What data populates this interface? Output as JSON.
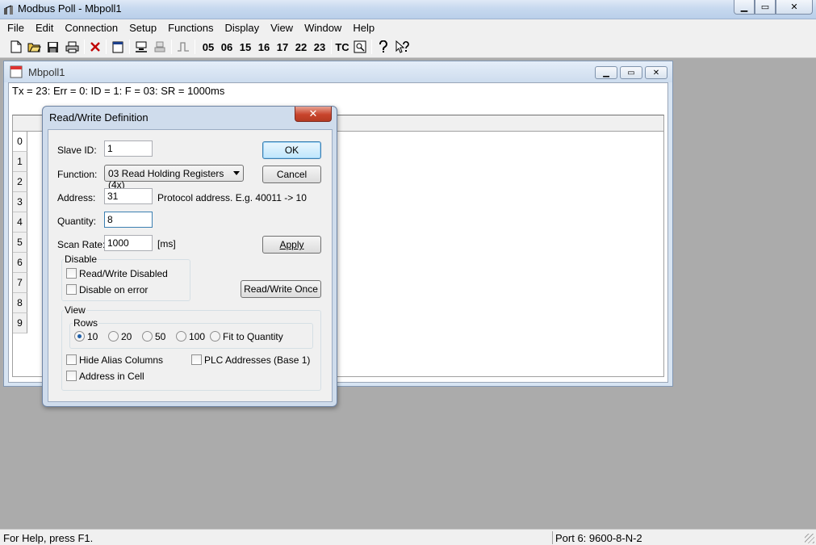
{
  "window": {
    "title": "Modbus Poll - Mbpoll1",
    "min_glyph": "▁",
    "max_glyph": "▭",
    "close_glyph": "✕"
  },
  "menu": [
    "File",
    "Edit",
    "Connection",
    "Setup",
    "Functions",
    "Display",
    "View",
    "Window",
    "Help"
  ],
  "toolbar": {
    "function_codes": [
      "05",
      "06",
      "15",
      "16",
      "17",
      "22",
      "23"
    ],
    "tc_label": "TC"
  },
  "child": {
    "title": "Mbpoll1",
    "status_line": "Tx = 23: Err = 0: ID = 1: F = 03: SR = 1000ms",
    "row_numbers": [
      "0",
      "1",
      "2",
      "3",
      "4",
      "5",
      "6",
      "7",
      "8",
      "9"
    ]
  },
  "dialog": {
    "title": "Read/Write Definition",
    "close_glyph": "✕",
    "slave_id_label": "Slave ID:",
    "slave_id_value": "1",
    "function_label": "Function:",
    "function_value": "03 Read Holding Registers (4x)",
    "address_label": "Address:",
    "address_value": "31",
    "address_hint": "Protocol address. E.g. 40011 -> 10",
    "quantity_label": "Quantity:",
    "quantity_value": "8",
    "scan_rate_label": "Scan Rate:",
    "scan_rate_value": "1000",
    "scan_rate_unit": "[ms]",
    "ok_label": "OK",
    "cancel_label": "Cancel",
    "apply_label": "Apply",
    "read_write_once_label": "Read/Write Once",
    "disable_group": "Disable",
    "rw_disabled_label": "Read/Write Disabled",
    "disable_on_error_label": "Disable on error",
    "view_group": "View",
    "rows_group": "Rows",
    "rows_options": [
      "10",
      "20",
      "50",
      "100",
      "Fit to Quantity"
    ],
    "rows_selected": "10",
    "hide_alias_label": "Hide Alias Columns",
    "plc_addresses_label": "PLC Addresses (Base 1)",
    "address_in_cell_label": "Address in Cell"
  },
  "statusbar": {
    "left": "For Help, press F1.",
    "right": "Port 6: 9600-8-N-2"
  }
}
